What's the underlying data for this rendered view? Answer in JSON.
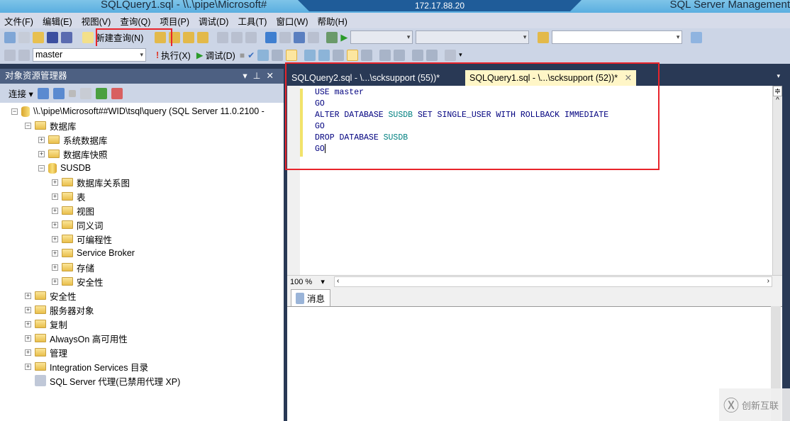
{
  "title": {
    "text": "SQLQuery1.sql - \\\\.\\pipe\\Microsoft#",
    "remote_host": "172.17.88.20",
    "app": "SQL Server Management"
  },
  "menu": [
    "文件(F)",
    "编辑(E)",
    "视图(V)",
    "查询(Q)",
    "项目(P)",
    "调试(D)",
    "工具(T)",
    "窗口(W)",
    "帮助(H)"
  ],
  "toolbar": {
    "new_query": "新建查询(N)",
    "database": "master",
    "execute": "执行(X)",
    "debug": "调试(D)"
  },
  "object_explorer": {
    "title": "对象资源管理器",
    "connect": "连接",
    "tree": [
      {
        "label": "\\\\.\\pipe\\Microsoft##WID\\tsql\\query (SQL Server 11.0.2100 -",
        "level": 0,
        "icon": "server-icon",
        "expander": "−"
      },
      {
        "label": "数据库",
        "level": 1,
        "icon": "folder",
        "expander": "−"
      },
      {
        "label": "系统数据库",
        "level": 2,
        "icon": "folder",
        "expander": "+"
      },
      {
        "label": "数据库快照",
        "level": 2,
        "icon": "folder",
        "expander": "+"
      },
      {
        "label": "SUSDB",
        "level": 2,
        "icon": "database",
        "expander": "−"
      },
      {
        "label": "数据库关系图",
        "level": 3,
        "icon": "folder",
        "expander": "+"
      },
      {
        "label": "表",
        "level": 3,
        "icon": "folder",
        "expander": "+"
      },
      {
        "label": "视图",
        "level": 3,
        "icon": "folder",
        "expander": "+"
      },
      {
        "label": "同义词",
        "level": 3,
        "icon": "folder",
        "expander": "+"
      },
      {
        "label": "可编程性",
        "level": 3,
        "icon": "folder",
        "expander": "+"
      },
      {
        "label": "Service Broker",
        "level": 3,
        "icon": "folder",
        "expander": "+"
      },
      {
        "label": "存储",
        "level": 3,
        "icon": "folder",
        "expander": "+"
      },
      {
        "label": "安全性",
        "level": 3,
        "icon": "folder",
        "expander": "+"
      },
      {
        "label": "安全性",
        "level": 1,
        "icon": "folder",
        "expander": "+"
      },
      {
        "label": "服务器对象",
        "level": 1,
        "icon": "folder",
        "expander": "+"
      },
      {
        "label": "复制",
        "level": 1,
        "icon": "folder",
        "expander": "+"
      },
      {
        "label": "AlwaysOn 高可用性",
        "level": 1,
        "icon": "folder",
        "expander": "+"
      },
      {
        "label": "管理",
        "level": 1,
        "icon": "folder",
        "expander": "+"
      },
      {
        "label": "Integration Services 目录",
        "level": 1,
        "icon": "folder",
        "expander": "+"
      },
      {
        "label": "SQL Server 代理(已禁用代理 XP)",
        "level": 1,
        "icon": "agent-icon",
        "expander": ""
      }
    ]
  },
  "tabs": [
    {
      "label": "SQLQuery2.sql - \\...\\scksupport (55))*",
      "active": false
    },
    {
      "label": "SQLQuery1.sql - \\...\\scksupport (52))*",
      "active": true
    }
  ],
  "code": [
    [
      {
        "t": "USE master",
        "c": "kw"
      }
    ],
    [
      {
        "t": "GO",
        "c": "kw"
      }
    ],
    [
      {
        "t": "ALTER DATABASE ",
        "c": "kw"
      },
      {
        "t": "SUSDB",
        "c": "obj"
      },
      {
        "t": " SET SINGLE_USER WITH ROLLBACK IMMEDIATE",
        "c": "kw"
      }
    ],
    [
      {
        "t": "GO",
        "c": "kw"
      }
    ],
    [
      {
        "t": "DROP DATABASE ",
        "c": "kw"
      },
      {
        "t": "SUSDB",
        "c": "obj"
      }
    ],
    [
      {
        "t": "GO",
        "c": "kw"
      }
    ]
  ],
  "zoom": "100 %",
  "results": {
    "tab": "消息"
  },
  "watermark": "创新互联",
  "colors": {
    "highlight": "#e8242b",
    "keyword": "#00007f",
    "object": "#008080"
  }
}
